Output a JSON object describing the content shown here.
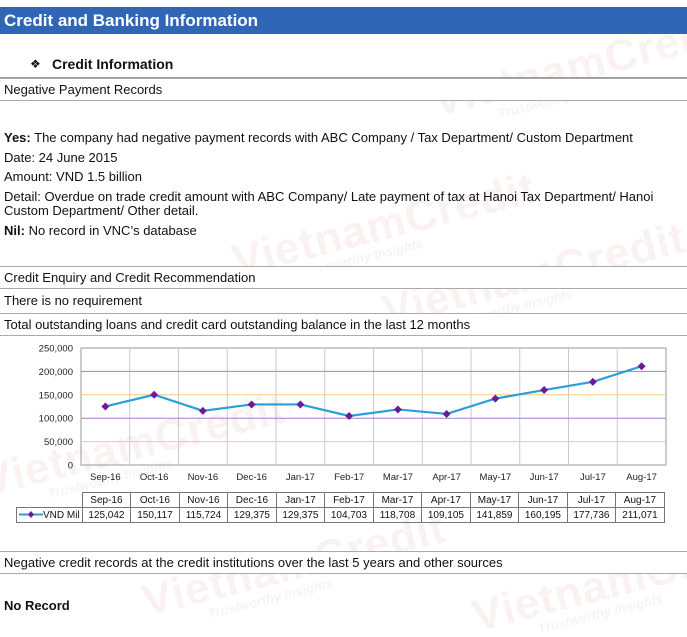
{
  "header": {
    "title": "Credit and Banking Information"
  },
  "credit_info": {
    "bullet": "❖",
    "title": "Credit Information"
  },
  "negative_payment": {
    "section_label": "Negative Payment Records",
    "yes_label": "Yes:",
    "yes_text": " The company had negative payment records with ABC Company / Tax Department/ Custom Department",
    "date": "Date: 24 June 2015",
    "amount": "Amount:  VND 1.5 billion",
    "detail_line1": "Detail: Overdue on trade credit amount with ABC Company/ Late payment of tax at Hanoi Tax Department/ Hanoi",
    "detail_line2": "Custom Department/ Other detail.",
    "nil_label": "Nil:",
    "nil_text": " No record in VNC’s database"
  },
  "credit_enquiry": {
    "section_label": "Credit Enquiry and Credit Recommendation",
    "text": "There is no requirement"
  },
  "outstanding": {
    "section_label": "Total outstanding loans and credit card outstanding balance in the last 12 months"
  },
  "chart_data": {
    "type": "line",
    "categories": [
      "Sep-16",
      "Oct-16",
      "Nov-16",
      "Dec-16",
      "Jan-17",
      "Feb-17",
      "Mar-17",
      "Apr-17",
      "May-17",
      "Jun-17",
      "Jul-17",
      "Aug-17"
    ],
    "series": [
      {
        "name": "VND Mil",
        "values": [
          125042,
          150117,
          115724,
          129375,
          129375,
          104703,
          118708,
          109105,
          141859,
          160195,
          177736,
          211071
        ]
      }
    ],
    "value_labels": [
      "125,042",
      "150,117",
      "115,724",
      "129,375",
      "129,375",
      "104,703",
      "118,708",
      "109,105",
      "141,859",
      "160,195",
      "177,736",
      "211,071"
    ],
    "y_ticks": [
      "0",
      "50,000",
      "100,000",
      "150,000",
      "200,000",
      "250,000"
    ],
    "ylim": [
      0,
      250000
    ],
    "grid": true,
    "legend": "table-bottom",
    "colors": {
      "line": "#2a9fd6",
      "marker": "#6a1b9a",
      "grid_orange": "#f5c88a",
      "grid_purple": "#b07cc6"
    }
  },
  "negative_credit": {
    "section_label": "Negative credit records at the credit institutions over the last 5 years and other sources",
    "text": "No Record"
  },
  "watermark": {
    "brand": "VietnamCredit",
    "tagline": "Trustworthy Insights"
  }
}
